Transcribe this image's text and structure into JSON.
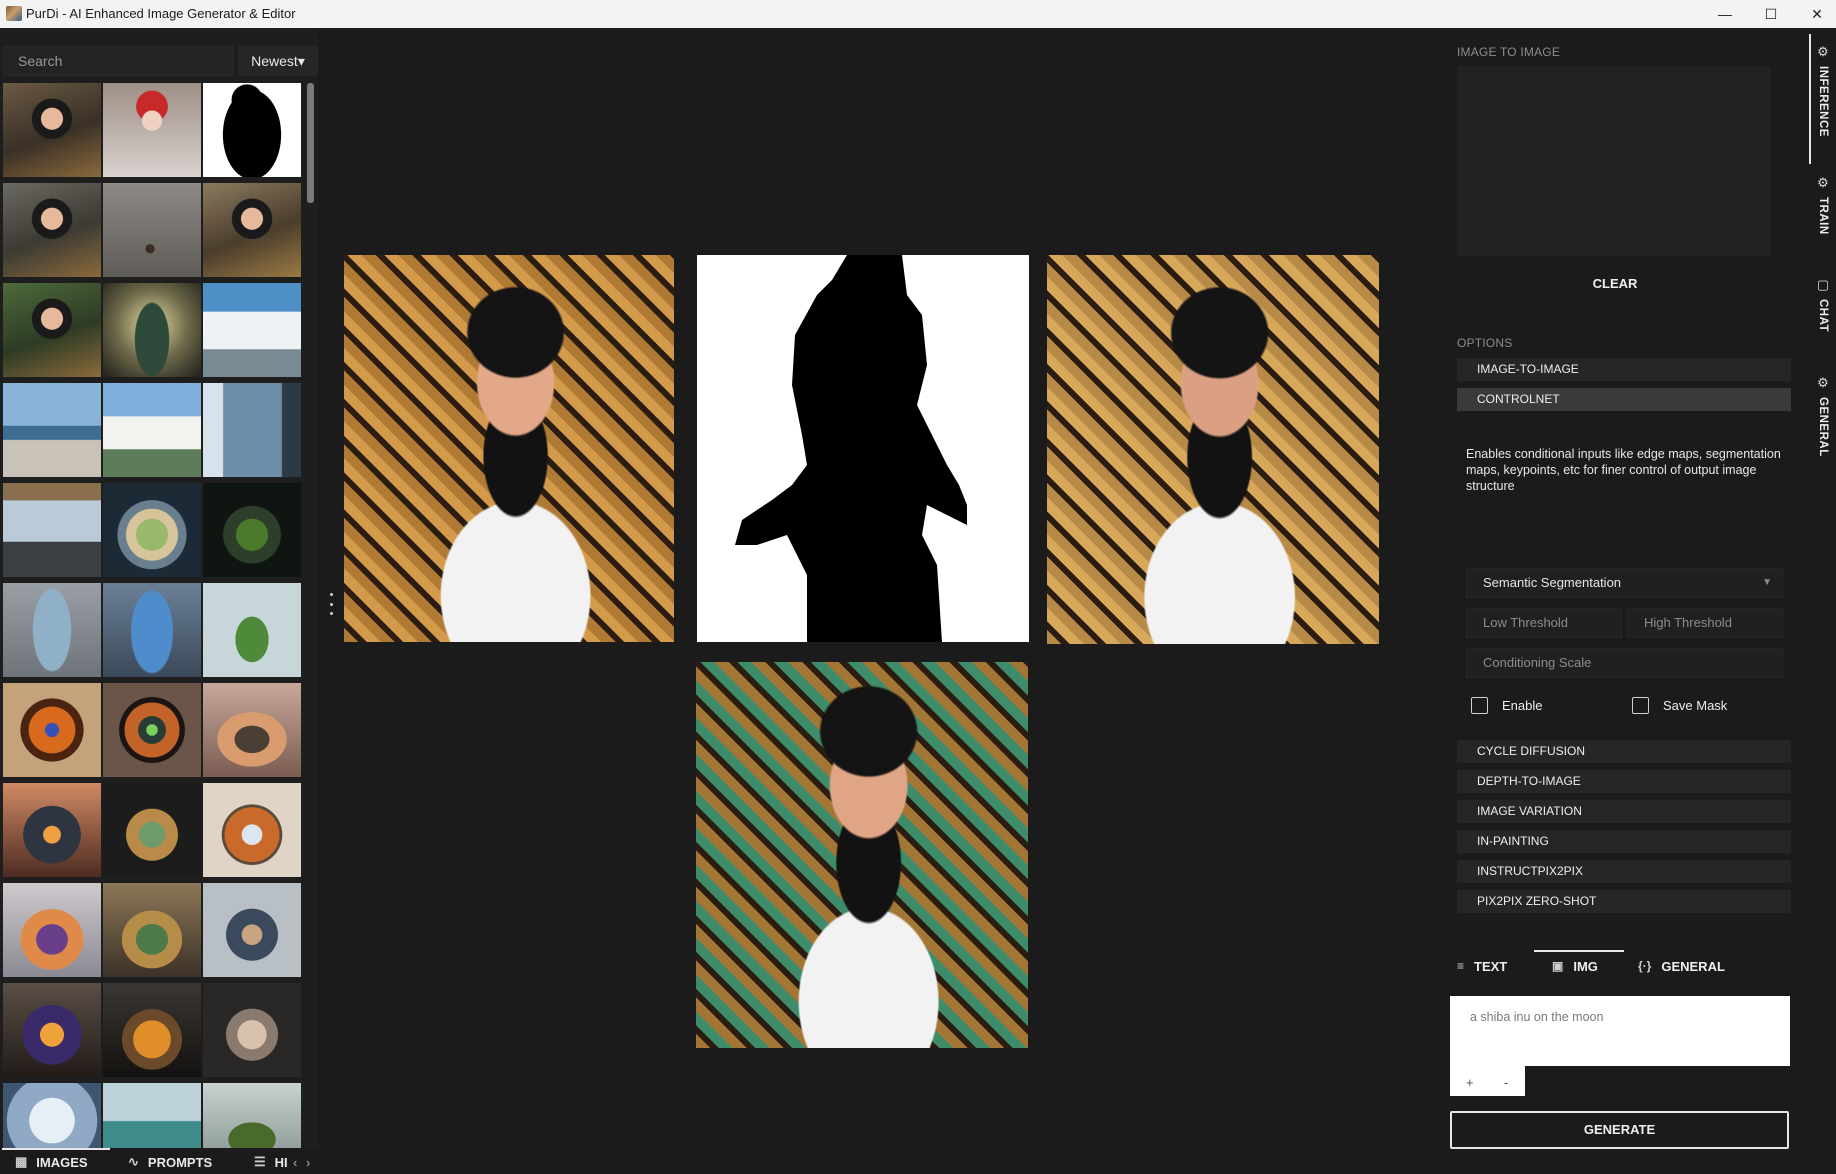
{
  "window": {
    "title": "PurDi - AI Enhanced Image Generator & Editor",
    "minimize_glyph": "—",
    "maximize_glyph": "☐",
    "close_glyph": "✕"
  },
  "gallery": {
    "search_placeholder": "Search",
    "sort_label": "Newest",
    "sort_caret": "▾"
  },
  "bottom_tabs": {
    "images": "IMAGES",
    "prompts": "PROMPTS",
    "history": "HI",
    "prev_glyph": "‹",
    "next_glyph": "›"
  },
  "right_panel": {
    "image_to_image_label": "IMAGE TO IMAGE",
    "clear_label": "CLEAR",
    "options_label": "OPTIONS",
    "options": [
      "IMAGE-TO-IMAGE",
      "CONTROLNET",
      "CYCLE DIFFUSION",
      "DEPTH-TO-IMAGE",
      "IMAGE VARIATION",
      "IN-PAINTING",
      "INSTRUCTPIX2PIX",
      "PIX2PIX ZERO-SHOT"
    ],
    "active_option": "CONTROLNET",
    "controlnet_description": "Enables conditional inputs like edge maps, segmentation maps, keypoints, etc for finer control of output image structure",
    "model_select_value": "Semantic Segmentation",
    "low_threshold_placeholder": "Low Threshold",
    "high_threshold_placeholder": "High Threshold",
    "conditioning_scale_placeholder": "Conditioning Scale",
    "enable_label": "Enable",
    "save_mask_label": "Save Mask"
  },
  "prompt_tabs": {
    "text": "TEXT",
    "img": "IMG",
    "general": "GENERAL",
    "active": "IMG"
  },
  "prompt": {
    "placeholder": "a shiba inu on the moon",
    "plus": "+",
    "minus": "-"
  },
  "generate_label": "GENERATE",
  "side_tabs": {
    "inference": "INFERENCE",
    "train": "TRAIN",
    "chat": "CHAT",
    "general": "GENERAL",
    "active": "INFERENCE"
  }
}
